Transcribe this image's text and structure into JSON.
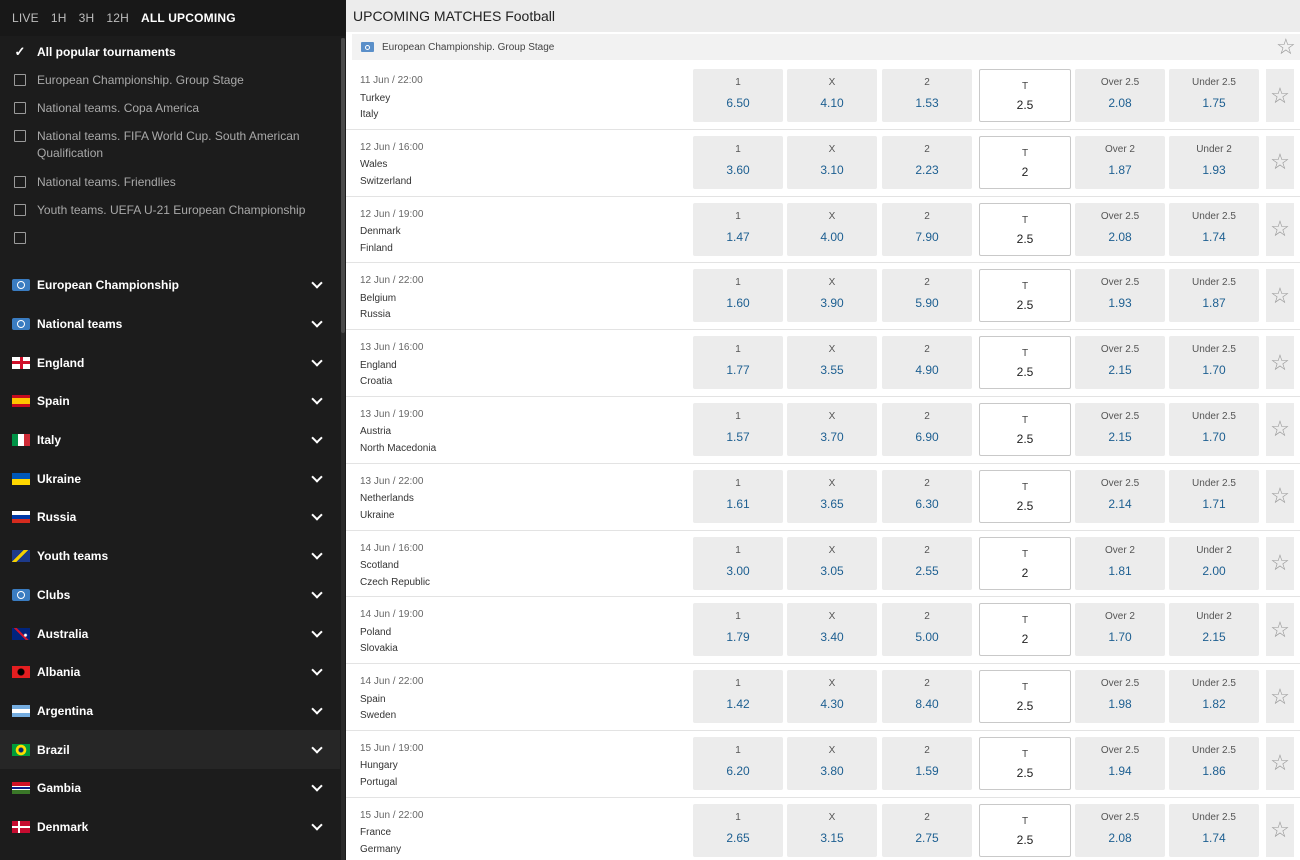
{
  "time_tabs": [
    "LIVE",
    "1H",
    "3H",
    "12H",
    "ALL UPCOMING"
  ],
  "active_time_tab": "ALL UPCOMING",
  "tournaments": [
    {
      "label": "All popular tournaments",
      "checked": true
    },
    {
      "label": "European Championship. Group Stage",
      "checked": false
    },
    {
      "label": "National teams. Copa America",
      "checked": false
    },
    {
      "label": "National teams. FIFA World Cup. South American Qualification",
      "checked": false
    },
    {
      "label": "National teams. Friendlies",
      "checked": false
    },
    {
      "label": "Youth teams. UEFA U-21 European Championship",
      "checked": false
    },
    {
      "label": "",
      "checked": false
    }
  ],
  "countries": [
    {
      "label": "European Championship",
      "icon": "globe-icon"
    },
    {
      "label": "National teams",
      "icon": "globe-icon"
    },
    {
      "label": "England",
      "icon": "flag-england"
    },
    {
      "label": "Spain",
      "icon": "flag-spain"
    },
    {
      "label": "Italy",
      "icon": "flag-italy"
    },
    {
      "label": "Ukraine",
      "icon": "flag-ukraine"
    },
    {
      "label": "Russia",
      "icon": "flag-russia"
    },
    {
      "label": "Youth teams",
      "icon": "youth-icon"
    },
    {
      "label": "Clubs",
      "icon": "globe-icon"
    },
    {
      "label": "Australia",
      "icon": "flag-australia"
    },
    {
      "label": "Albania",
      "icon": "flag-albania"
    },
    {
      "label": "Argentina",
      "icon": "flag-argentina"
    },
    {
      "label": "Brazil",
      "icon": "flag-brazil"
    },
    {
      "label": "Gambia",
      "icon": "flag-gambia"
    },
    {
      "label": "Denmark",
      "icon": "flag-denmark"
    }
  ],
  "header": {
    "title": "UPCOMING MATCHES Football"
  },
  "league": {
    "name": "European Championship. Group Stage"
  },
  "matches": [
    {
      "date": "11 Jun / 22:00",
      "home": "Turkey",
      "away": "Italy",
      "odds": [
        "6.50",
        "4.10",
        "1.53"
      ],
      "total": "2.5",
      "over_label": "Over 2.5",
      "over": "2.08",
      "under_label": "Under 2.5",
      "under": "1.75"
    },
    {
      "date": "12 Jun / 16:00",
      "home": "Wales",
      "away": "Switzerland",
      "odds": [
        "3.60",
        "3.10",
        "2.23"
      ],
      "total": "2",
      "over_label": "Over 2",
      "over": "1.87",
      "under_label": "Under 2",
      "under": "1.93"
    },
    {
      "date": "12 Jun / 19:00",
      "home": "Denmark",
      "away": "Finland",
      "odds": [
        "1.47",
        "4.00",
        "7.90"
      ],
      "total": "2.5",
      "over_label": "Over 2.5",
      "over": "2.08",
      "under_label": "Under 2.5",
      "under": "1.74"
    },
    {
      "date": "12 Jun / 22:00",
      "home": "Belgium",
      "away": "Russia",
      "odds": [
        "1.60",
        "3.90",
        "5.90"
      ],
      "total": "2.5",
      "over_label": "Over 2.5",
      "over": "1.93",
      "under_label": "Under 2.5",
      "under": "1.87"
    },
    {
      "date": "13 Jun / 16:00",
      "home": "England",
      "away": "Croatia",
      "odds": [
        "1.77",
        "3.55",
        "4.90"
      ],
      "total": "2.5",
      "over_label": "Over 2.5",
      "over": "2.15",
      "under_label": "Under 2.5",
      "under": "1.70"
    },
    {
      "date": "13 Jun / 19:00",
      "home": "Austria",
      "away": "North Macedonia",
      "odds": [
        "1.57",
        "3.70",
        "6.90"
      ],
      "total": "2.5",
      "over_label": "Over 2.5",
      "over": "2.15",
      "under_label": "Under 2.5",
      "under": "1.70"
    },
    {
      "date": "13 Jun / 22:00",
      "home": "Netherlands",
      "away": "Ukraine",
      "odds": [
        "1.61",
        "3.65",
        "6.30"
      ],
      "total": "2.5",
      "over_label": "Over 2.5",
      "over": "2.14",
      "under_label": "Under 2.5",
      "under": "1.71"
    },
    {
      "date": "14 Jun / 16:00",
      "home": "Scotland",
      "away": "Czech Republic",
      "odds": [
        "3.00",
        "3.05",
        "2.55"
      ],
      "total": "2",
      "over_label": "Over 2",
      "over": "1.81",
      "under_label": "Under 2",
      "under": "2.00"
    },
    {
      "date": "14 Jun / 19:00",
      "home": "Poland",
      "away": "Slovakia",
      "odds": [
        "1.79",
        "3.40",
        "5.00"
      ],
      "total": "2",
      "over_label": "Over 2",
      "over": "1.70",
      "under_label": "Under 2",
      "under": "2.15"
    },
    {
      "date": "14 Jun / 22:00",
      "home": "Spain",
      "away": "Sweden",
      "odds": [
        "1.42",
        "4.30",
        "8.40"
      ],
      "total": "2.5",
      "over_label": "Over 2.5",
      "over": "1.98",
      "under_label": "Under 2.5",
      "under": "1.82"
    },
    {
      "date": "15 Jun / 19:00",
      "home": "Hungary",
      "away": "Portugal",
      "odds": [
        "6.20",
        "3.80",
        "1.59"
      ],
      "total": "2.5",
      "over_label": "Over 2.5",
      "over": "1.94",
      "under_label": "Under 2.5",
      "under": "1.86"
    },
    {
      "date": "15 Jun / 22:00",
      "home": "France",
      "away": "Germany",
      "odds": [
        "2.65",
        "3.15",
        "2.75"
      ],
      "total": "2.5",
      "over_label": "Over 2.5",
      "over": "2.08",
      "under_label": "Under 2.5",
      "under": "1.74"
    }
  ],
  "odds_labels": [
    "1",
    "X",
    "2"
  ],
  "total_label": "T"
}
